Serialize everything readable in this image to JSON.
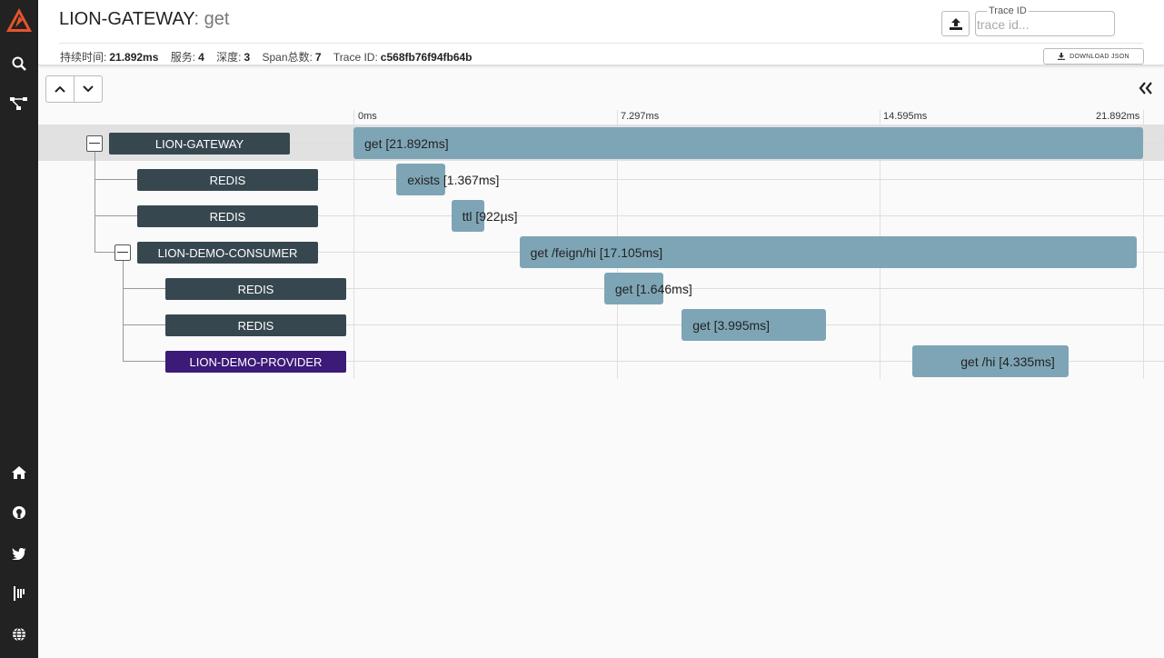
{
  "app": {
    "brand_color": "#e8542c"
  },
  "sidebar": {
    "top_icons": [
      "zipkin-logo-icon",
      "search-icon",
      "dependencies-icon"
    ],
    "bottom_icons": [
      "home-icon",
      "github-icon",
      "twitter-icon",
      "gitter-icon",
      "language-icon"
    ]
  },
  "header": {
    "service": "LION-GATEWAY",
    "operation": ": get",
    "meta": {
      "duration_label": "持续时间:",
      "duration_value": "21.892ms",
      "services_label": "服务:",
      "services_value": "4",
      "depth_label": "深度:",
      "depth_value": "3",
      "spans_label": "Span总数:",
      "spans_value": "7",
      "traceid_label": "Trace ID:",
      "traceid_value": "c568fb76f94fb64b"
    },
    "trace_id_field": {
      "legend": "Trace ID",
      "placeholder": "trace id...",
      "value": ""
    },
    "download_label": "DOWNLOAD JSON"
  },
  "timeline": {
    "ticks": [
      "0ms",
      "7.297ms",
      "14.595ms",
      "21.892ms"
    ],
    "rows": [
      {
        "service": "LION-GATEWAY",
        "bar_label": "get [21.892ms]",
        "depth": 0,
        "expandable": true,
        "selected": true,
        "start_ms": 0,
        "duration_ms": 21.892
      },
      {
        "service": "REDIS",
        "bar_label": "exists [1.367ms]",
        "depth": 1,
        "expandable": false,
        "selected": false,
        "start_ms": 1.19,
        "duration_ms": 1.367
      },
      {
        "service": "REDIS",
        "bar_label": "ttl [922µs]",
        "depth": 1,
        "expandable": false,
        "selected": false,
        "start_ms": 2.71,
        "duration_ms": 0.922
      },
      {
        "service": "LION-DEMO-CONSUMER",
        "bar_label": "get /feign/hi [17.105ms]",
        "depth": 1,
        "expandable": true,
        "selected": false,
        "start_ms": 4.6,
        "duration_ms": 17.105
      },
      {
        "service": "REDIS",
        "bar_label": "get [1.646ms]",
        "depth": 2,
        "expandable": false,
        "selected": false,
        "start_ms": 6.95,
        "duration_ms": 1.646
      },
      {
        "service": "REDIS",
        "bar_label": "get [3.995ms]",
        "depth": 2,
        "expandable": false,
        "selected": false,
        "start_ms": 9.1,
        "duration_ms": 3.995
      },
      {
        "service": "LION-DEMO-PROVIDER",
        "bar_label": "get /hi [4.335ms]",
        "depth": 2,
        "expandable": false,
        "selected": false,
        "start_ms": 15.5,
        "duration_ms": 4.335
      }
    ]
  }
}
